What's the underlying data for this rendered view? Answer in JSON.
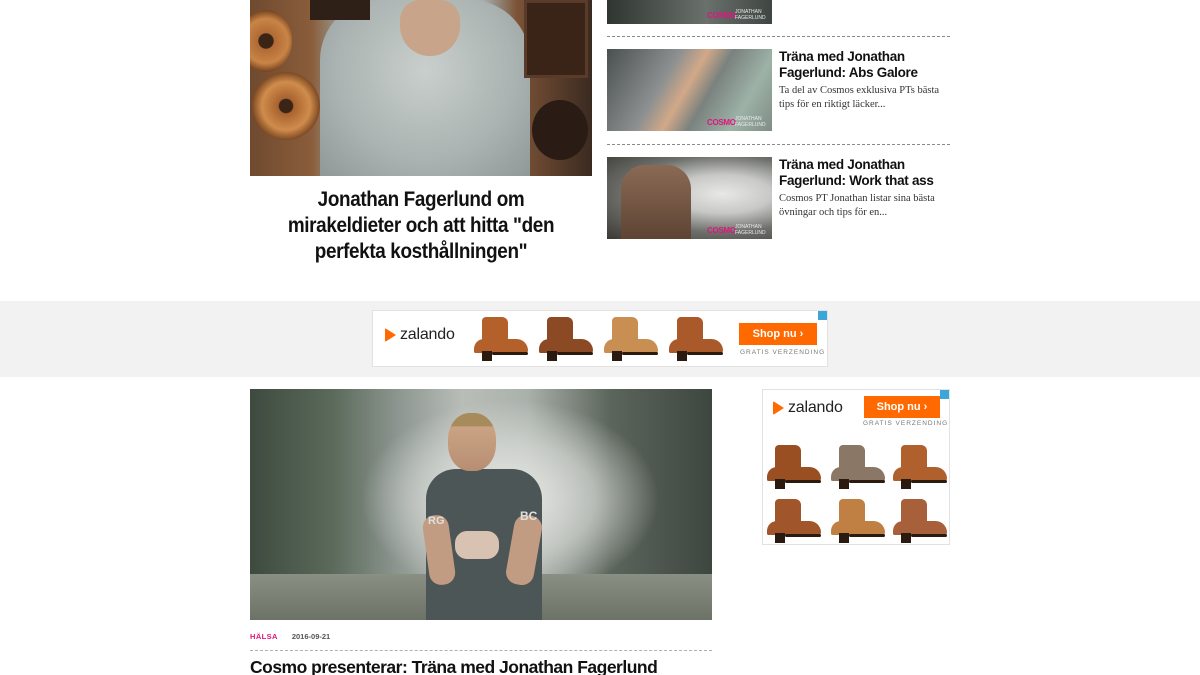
{
  "featured": {
    "title": "Jonathan Fagerlund om mirakeldieter och att hitta \"den perfekta kosthållningen\""
  },
  "side_articles": [
    {
      "brand": "COSMO",
      "brand_sub": "JONATHAN FAGERLUND"
    },
    {
      "title": "Träna med Jonathan Fagerlund: Abs Galore",
      "excerpt": "Ta del av Cosmos exklusiva PTs bästa tips för en riktigt läcker...",
      "brand": "COSMO",
      "brand_sub": "JONATHAN FAGERLUND"
    },
    {
      "title": "Träna med Jonathan Fagerlund: Work that ass",
      "excerpt": "Cosmos PT Jonathan listar sina bästa övningar och tips för en...",
      "brand": "COSMO",
      "brand_sub": "JONATHAN FAGERLUND"
    }
  ],
  "ad_banner": {
    "brand": "zalando",
    "cta": "Shop nu",
    "shipping": "GRATIS VERZENDING",
    "colors": {
      "accent": "#ff6900",
      "adchoice": "#3da6d8"
    },
    "boots": [
      "#b4602b",
      "#8c4a24",
      "#c98f52",
      "#a9592a"
    ]
  },
  "ad_side": {
    "brand": "zalando",
    "cta": "Shop nu",
    "shipping": "GRATIS VERZENDING",
    "boots": [
      "#9a4f22",
      "#8b7766",
      "#b0602c",
      "#a0552a",
      "#c08043",
      "#a8603a"
    ]
  },
  "article": {
    "category": "HÄLSA",
    "date": "2016-09-21",
    "title": "Cosmo presenterar: Träna med Jonathan Fagerlund",
    "image_logo_left": "RG",
    "image_logo_right": "BC"
  },
  "colors": {
    "category": "#e0157f",
    "ad_band": "#f2f2f2"
  }
}
